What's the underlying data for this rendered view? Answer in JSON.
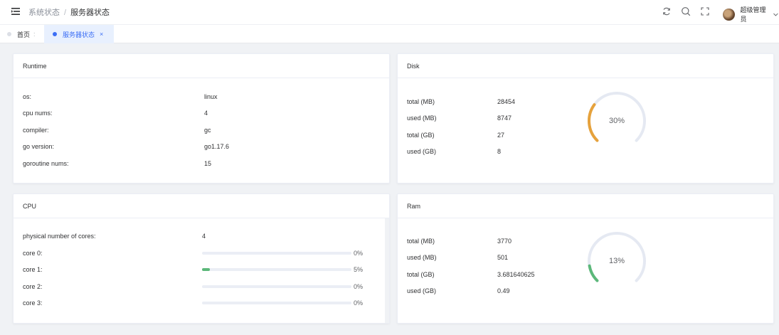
{
  "header": {
    "breadcrumb": [
      "系统状态",
      "服务器状态"
    ],
    "breadcrumb_sep": "/",
    "icons": [
      "refresh-icon",
      "search-icon",
      "fullscreen-icon"
    ],
    "user_name": "超级管理员"
  },
  "tabs": [
    {
      "label": "首页",
      "suffix": ":"
    },
    {
      "label": "服务器状态",
      "close": "×"
    }
  ],
  "runtime": {
    "title": "Runtime",
    "rows": [
      {
        "label": "os:",
        "value": "linux"
      },
      {
        "label": "cpu nums:",
        "value": "4"
      },
      {
        "label": "compiler:",
        "value": "gc"
      },
      {
        "label": "go version:",
        "value": "go1.17.6"
      },
      {
        "label": "goroutine nums:",
        "value": "15"
      }
    ]
  },
  "disk": {
    "title": "Disk",
    "rows": [
      {
        "label": "total (MB)",
        "value": "28454"
      },
      {
        "label": "used (MB)",
        "value": "8747"
      },
      {
        "label": "total (GB)",
        "value": "27"
      },
      {
        "label": "used (GB)",
        "value": "8"
      }
    ],
    "gauge_text": "30%",
    "gauge_fraction": 0.3,
    "gauge_color": "#e6a23c"
  },
  "cpu": {
    "title": "CPU",
    "cores_label": "physical number of cores:",
    "cores_value": "4",
    "cores": [
      {
        "label": "core 0:",
        "percent": 0,
        "text": "0%"
      },
      {
        "label": "core 1:",
        "percent": 5,
        "text": "5%"
      },
      {
        "label": "core 2:",
        "percent": 0,
        "text": "0%"
      },
      {
        "label": "core 3:",
        "percent": 0,
        "text": "0%"
      }
    ],
    "bar_color": "#5cb87a"
  },
  "ram": {
    "title": "Ram",
    "rows": [
      {
        "label": "total (MB)",
        "value": "3770"
      },
      {
        "label": "used (MB)",
        "value": "501"
      },
      {
        "label": "total (GB)",
        "value": "3.681640625"
      },
      {
        "label": "used (GB)",
        "value": "0.49"
      }
    ],
    "gauge_text": "13%",
    "gauge_fraction": 0.13,
    "gauge_color": "#5cb87a"
  },
  "colors": {
    "accent": "#3b6ef5",
    "gauge_track": "#e5e9f2"
  }
}
